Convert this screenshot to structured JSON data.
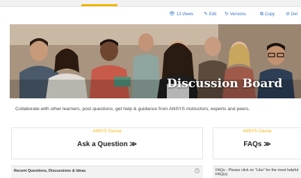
{
  "page": {
    "actions": [
      {
        "icon": "eye-icon",
        "glyph": "👁",
        "label": "13 Views"
      },
      {
        "icon": "pencil-icon",
        "glyph": "✎",
        "label": "Edit"
      },
      {
        "icon": "versions-icon",
        "glyph": "↻",
        "label": "Versions"
      },
      {
        "icon": "copy-icon",
        "glyph": "⧉",
        "label": "Copy"
      },
      {
        "icon": "delete-icon",
        "glyph": "⊘",
        "label": "Del"
      }
    ],
    "banner_title": "Discussion Board",
    "tagline": "Collaborate with other learners, post questions, get help & guidance from ANSYS instructors, experts and peers.",
    "cards": [
      {
        "kicker": "ANSYS Course",
        "cta": "Ask a Question ≫"
      },
      {
        "kicker": "ANSYS Course",
        "cta": "FAQs ≫"
      }
    ],
    "sections": [
      {
        "title": "Recent Questions, Discussions & Ideas",
        "info": "i"
      },
      {
        "title": "FAQs - Please click on \"Like\" for the most helpful FAQ(s)"
      }
    ]
  },
  "colors": {
    "accent": "#f0b400",
    "link": "#2d74c4"
  }
}
